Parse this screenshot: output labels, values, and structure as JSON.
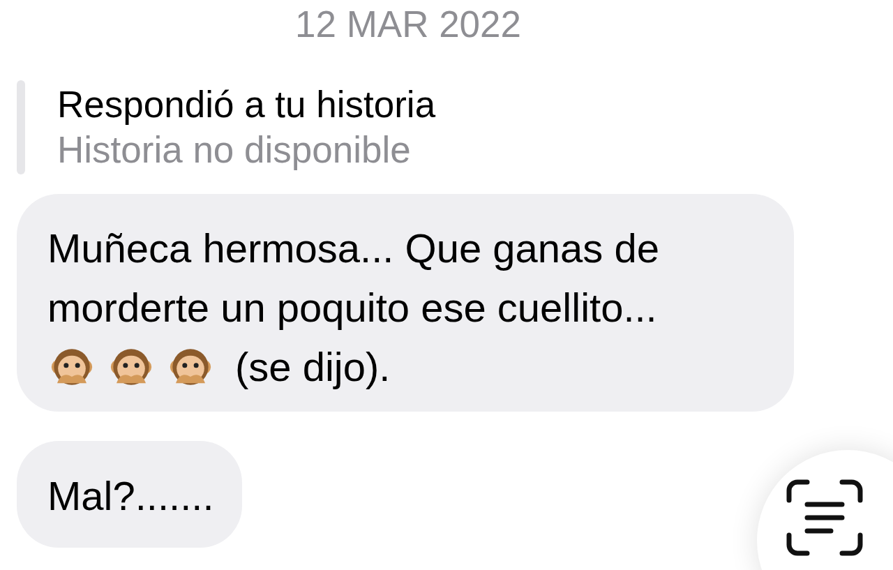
{
  "date_divider": "12 MAR 2022",
  "story_reply": {
    "label": "Respondió a tu historia",
    "status": "Historia no disponible"
  },
  "messages": [
    {
      "text": "Muñeca hermosa... Que ganas de morderte un poquito ese cuellito...",
      "emojis": [
        {
          "kind": "speak-no-evil-monkey"
        },
        {
          "kind": "speak-no-evil-monkey"
        },
        {
          "kind": "speak-no-evil-monkey"
        }
      ],
      "trailing_text": "(se dijo)."
    },
    {
      "text": "Mal?......."
    }
  ]
}
